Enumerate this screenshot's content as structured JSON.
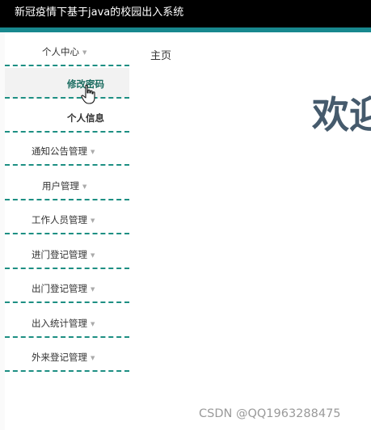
{
  "app": {
    "title": "新冠疫情下基于java的校园出入系统"
  },
  "sidebar": {
    "items": [
      {
        "label": "个人中心",
        "expanded": true,
        "children": [
          {
            "label": "修改密码",
            "active": true
          },
          {
            "label": "个人信息",
            "active": false
          }
        ]
      },
      {
        "label": "通知公告管理"
      },
      {
        "label": "用户管理"
      },
      {
        "label": "工作人员管理"
      },
      {
        "label": "进门登记管理"
      },
      {
        "label": "出门登记管理"
      },
      {
        "label": "出入统计管理"
      },
      {
        "label": "外来登记管理"
      }
    ]
  },
  "main": {
    "tab": "主页",
    "welcome": "欢迎"
  },
  "watermark": "CSDN @QQ1963288475",
  "colors": {
    "topbar": "#000000",
    "accent": "#18888e",
    "divider": "#1d8f83",
    "welcome_text": "#455a6c"
  }
}
